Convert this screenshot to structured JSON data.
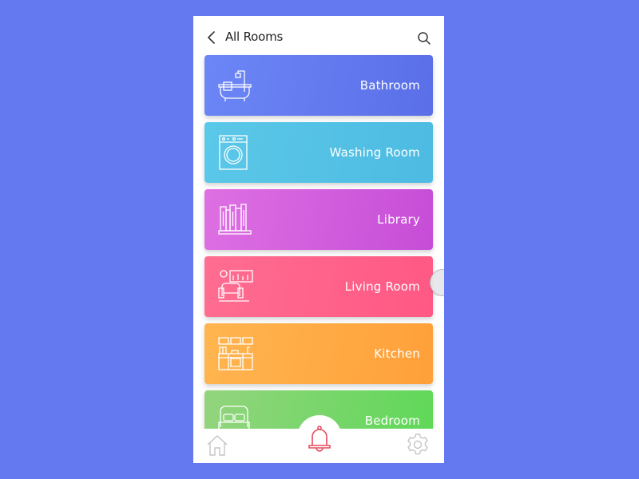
{
  "header": {
    "title": "All Rooms",
    "back_icon": "chevron-left-icon",
    "search_icon": "search-icon"
  },
  "rooms": [
    {
      "label": "Bathroom",
      "icon": "bathtub-icon",
      "color_start": "#6a85f5",
      "color_end": "#5b70e8"
    },
    {
      "label": "Washing Room",
      "icon": "washing-machine-icon",
      "color_start": "#56c5e6",
      "color_end": "#4fbde3"
    },
    {
      "label": "Library",
      "icon": "books-icon",
      "color_start": "#dc6be0",
      "color_end": "#c74fd8"
    },
    {
      "label": "Living Room",
      "icon": "sofa-icon",
      "color_start": "#ff6a8f",
      "color_end": "#ff5a85"
    },
    {
      "label": "Kitchen",
      "icon": "kitchen-icon",
      "color_start": "#ffb14d",
      "color_end": "#ffa23d"
    },
    {
      "label": "Bedroom",
      "icon": "bed-icon",
      "color_start": "#8ed67a",
      "color_end": "#63d65a"
    }
  ],
  "bottom_nav": {
    "items": [
      {
        "name": "home",
        "icon": "home-icon",
        "active": false
      },
      {
        "name": "notifications",
        "icon": "bell-icon",
        "active": true,
        "color": "#e84a5f"
      },
      {
        "name": "settings",
        "icon": "gear-icon",
        "active": false
      }
    ]
  },
  "colors": {
    "background": "#6479f0",
    "inactive_icon": "#c4c4c4",
    "active_icon": "#e84a5f"
  }
}
